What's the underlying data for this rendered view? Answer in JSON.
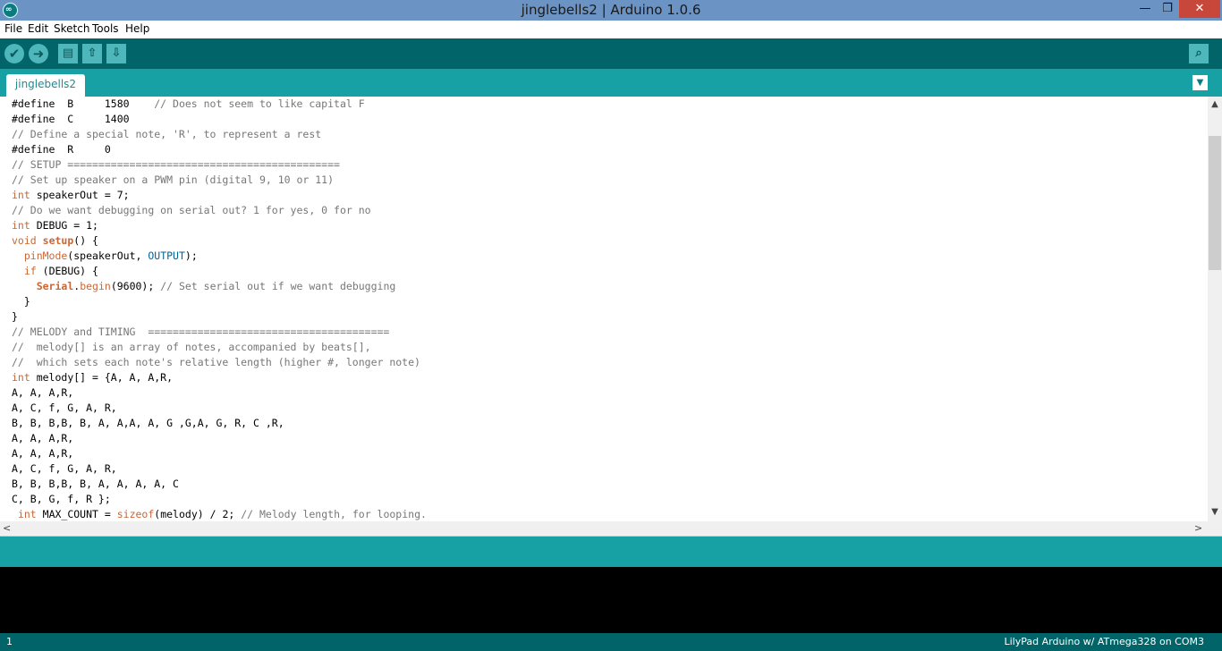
{
  "window": {
    "title": "jinglebells2 | Arduino 1.0.6",
    "minimize": "—",
    "maximize": "❐",
    "close": "✕",
    "app_icon": "∞"
  },
  "menu": [
    "File",
    "Edit",
    "Sketch",
    "Tools",
    "Help"
  ],
  "toolbar": {
    "verify_icon": "✔",
    "upload_icon": "➜",
    "new_icon": "▤",
    "open_icon": "⇧",
    "save_icon": "⇩",
    "serial_monitor_icon": "⌕"
  },
  "tab": {
    "label": "jinglebells2",
    "menu_icon": "▼"
  },
  "scroll": {
    "up": "▲",
    "down": "▼",
    "left": "<",
    "right": ">"
  },
  "code_lines": [
    "#define  B     1580    // Does not seem to like capital F",
    "#define  C     1400",
    "// Define a special note, 'R', to represent a rest",
    "#define  R     0",
    "// SETUP ============================================",
    "// Set up speaker on a PWM pin (digital 9, 10 or 11)",
    "int speakerOut = 7;",
    "// Do we want debugging on serial out? 1 for yes, 0 for no",
    "int DEBUG = 1;",
    "void setup() {",
    "  pinMode(speakerOut, OUTPUT);",
    "  if (DEBUG) {",
    "    Serial.begin(9600); // Set serial out if we want debugging",
    "  }",
    "}",
    "// MELODY and TIMING  =======================================",
    "//  melody[] is an array of notes, accompanied by beats[],",
    "//  which sets each note's relative length (higher #, longer note)",
    "int melody[] = {A, A, A,R,",
    "A, A, A,R,",
    "A, C, f, G, A, R,",
    "B, B, B,B, B, A, A,A, A, G ,G,A, G, R, C ,R,",
    "A, A, A,R,",
    "A, A, A,R,",
    "A, C, f, G, A, R,",
    "B, B, B,B, B, A, A, A, A, C",
    "C, B, G, f, R };",
    " int MAX_COUNT = sizeof(melody) / 2; // Melody length, for looping."
  ],
  "status": {
    "line_number": "1",
    "board": "LilyPad Arduino w/ ATmega328 on COM3"
  }
}
